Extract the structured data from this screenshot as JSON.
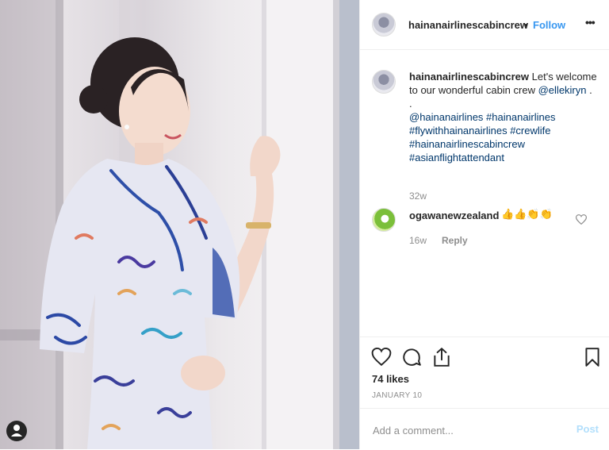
{
  "post": {
    "username": "hainanairlinescabincrew",
    "follow_label": "Follow",
    "separator": "•",
    "more_label": "•••"
  },
  "caption": {
    "username": "hainanairlinescabincrew",
    "text1": "Let's welcome to our wonderful cabin crew",
    "mention": "@ellekiryn",
    "text2": " .",
    "dot_line": ".",
    "tags": [
      "@hainanairlines",
      "#hainanairlines",
      "#flywithhainanairlines",
      "#crewlife",
      "#hainanairlinescabincrew",
      "#asianflightattendant"
    ],
    "time": "32w"
  },
  "comment": {
    "username": "ogawanewzealand",
    "text": "👍👍👏👏",
    "time": "16w",
    "reply_label": "Reply"
  },
  "stats": {
    "likes": "74 likes",
    "date": "JANUARY 10"
  },
  "add_comment": {
    "placeholder": "Add a comment...",
    "post_label": "Post"
  },
  "colors": {
    "link": "#00376b",
    "follow": "#3897f0",
    "meta": "#8e8e8e",
    "post_disabled": "#b2dffc"
  }
}
